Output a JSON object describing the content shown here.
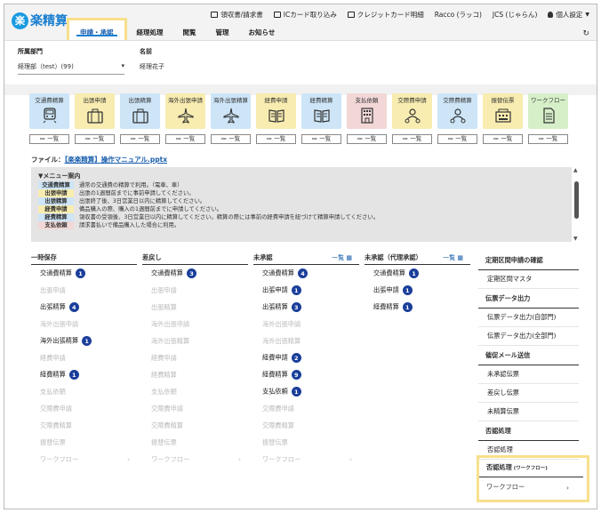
{
  "app": {
    "logo_mark": "楽",
    "logo_text": "楽精算"
  },
  "utils": [
    {
      "label": "領収書/請求書",
      "icon": "receipt-icon"
    },
    {
      "label": "ICカード取り込み",
      "icon": "ic-card-icon"
    },
    {
      "label": "クレジットカード明細",
      "icon": "credit-card-icon"
    },
    {
      "label": "Racco (ラッコ)",
      "icon": ""
    },
    {
      "label": "JCS (じゃらん)",
      "icon": ""
    },
    {
      "label": "個人設定",
      "icon": "person-icon"
    }
  ],
  "tabs": [
    "申請・承認",
    "経理処理",
    "閲覧",
    "管理",
    "お知らせ"
  ],
  "refresh_icon": "↻",
  "dept": {
    "label": "所属部門",
    "value": "経理部（test）(99)"
  },
  "name": {
    "label": "名前",
    "value": "経理花子"
  },
  "cards": [
    {
      "label": "交通費精算",
      "color": "blue",
      "icon": "train"
    },
    {
      "label": "出張申請",
      "color": "yellow",
      "icon": "bag"
    },
    {
      "label": "出張精算",
      "color": "blue",
      "icon": "bag"
    },
    {
      "label": "海外出張申請",
      "color": "yellow",
      "icon": "plane"
    },
    {
      "label": "海外出張精算",
      "color": "blue",
      "icon": "plane"
    },
    {
      "label": "経費申請",
      "color": "yellow",
      "icon": "book"
    },
    {
      "label": "経費精算",
      "color": "blue",
      "icon": "book"
    },
    {
      "label": "支払依頼",
      "color": "pink",
      "icon": "building"
    },
    {
      "label": "交際費申請",
      "color": "yellow",
      "icon": "people"
    },
    {
      "label": "交際費精算",
      "color": "blue",
      "icon": "people"
    },
    {
      "label": "振替伝票",
      "color": "yellow",
      "icon": "register"
    },
    {
      "label": "ワークフロー",
      "color": "green",
      "icon": "doc"
    }
  ],
  "list_button": "≔ 一覧",
  "manual": {
    "prefix": "ファイル：",
    "link": "【楽楽精算】操作マニュアル.pptx"
  },
  "menu_guide": {
    "title": "▼メニュー案内",
    "rows": [
      {
        "tag": "交通費精算",
        "color": "#cde5f7",
        "text": "通常の交通費の精算で利用。（電車、車）"
      },
      {
        "tag": "出張申請",
        "color": "#f8ecb0",
        "text": "出張の1週間前までに事前申請してください。"
      },
      {
        "tag": "出張精算",
        "color": "#cde5f7",
        "text": "出張終了後、3日営業日以内に精算してください。"
      },
      {
        "tag": "経費申請",
        "color": "#f8ecb0",
        "text": "備品購入の際、購入の1週間前までに申請してください。"
      },
      {
        "tag": "経費精算",
        "color": "#cde5f7",
        "text": "領収書の受領後、3日営業日以内に精算してください。精算の際には事前の経費申請を紐づけて精算申請してください。"
      },
      {
        "tag": "支払依頼",
        "color": "#f2d7d7",
        "text": "請求書払いで備品購入した場合に利用。"
      }
    ]
  },
  "columns": [
    {
      "title": "一時保存",
      "link": "",
      "items": [
        {
          "label": "交通費精算",
          "badge": "1",
          "enabled": true
        },
        {
          "label": "出張申請",
          "badge": "",
          "enabled": false
        },
        {
          "label": "出張精算",
          "badge": "4",
          "enabled": true
        },
        {
          "label": "海外出張申請",
          "badge": "",
          "enabled": false
        },
        {
          "label": "海外出張精算",
          "badge": "1",
          "enabled": true
        },
        {
          "label": "経費申請",
          "badge": "",
          "enabled": false
        },
        {
          "label": "経費精算",
          "badge": "1",
          "enabled": true
        },
        {
          "label": "支払依頼",
          "badge": "",
          "enabled": false
        },
        {
          "label": "交際費申請",
          "badge": "",
          "enabled": false
        },
        {
          "label": "交際費精算",
          "badge": "",
          "enabled": false
        },
        {
          "label": "振替伝票",
          "badge": "",
          "enabled": false
        },
        {
          "label": "ワークフロー",
          "badge": "",
          "enabled": false,
          "arrow": "›"
        }
      ]
    },
    {
      "title": "差戻し",
      "link": "",
      "items": [
        {
          "label": "交通費精算",
          "badge": "3",
          "enabled": true
        },
        {
          "label": "出張申請",
          "badge": "",
          "enabled": false
        },
        {
          "label": "出張精算",
          "badge": "",
          "enabled": false
        },
        {
          "label": "海外出張申請",
          "badge": "",
          "enabled": false
        },
        {
          "label": "海外出張精算",
          "badge": "",
          "enabled": false
        },
        {
          "label": "経費申請",
          "badge": "",
          "enabled": false
        },
        {
          "label": "経費精算",
          "badge": "",
          "enabled": false
        },
        {
          "label": "支払依頼",
          "badge": "",
          "enabled": false
        },
        {
          "label": "交際費申請",
          "badge": "",
          "enabled": false
        },
        {
          "label": "交際費精算",
          "badge": "",
          "enabled": false
        },
        {
          "label": "振替伝票",
          "badge": "",
          "enabled": false
        },
        {
          "label": "ワークフロー",
          "badge": "",
          "enabled": false,
          "arrow": "›"
        }
      ]
    },
    {
      "title": "未承認",
      "link": "一覧 ▦",
      "items": [
        {
          "label": "交通費精算",
          "badge": "4",
          "enabled": true
        },
        {
          "label": "出張申請",
          "badge": "1",
          "enabled": true
        },
        {
          "label": "出張精算",
          "badge": "3",
          "enabled": true
        },
        {
          "label": "海外出張申請",
          "badge": "",
          "enabled": false
        },
        {
          "label": "海外出張精算",
          "badge": "",
          "enabled": false
        },
        {
          "label": "経費申請",
          "badge": "2",
          "enabled": true
        },
        {
          "label": "経費精算",
          "badge": "9",
          "enabled": true
        },
        {
          "label": "支払依頼",
          "badge": "1",
          "enabled": true
        },
        {
          "label": "交際費申請",
          "badge": "",
          "enabled": false
        },
        {
          "label": "交際費精算",
          "badge": "",
          "enabled": false
        },
        {
          "label": "振替伝票",
          "badge": "",
          "enabled": false
        },
        {
          "label": "ワークフロー",
          "badge": "",
          "enabled": false,
          "arrow": "›"
        }
      ]
    },
    {
      "title": "未承認（代理承認）",
      "link": "一覧 ▦",
      "items": [
        {
          "label": "交通費精算",
          "badge": "1",
          "enabled": true
        },
        {
          "label": "出張申請",
          "badge": "1",
          "enabled": true
        },
        {
          "label": "経費精算",
          "badge": "1",
          "enabled": true
        }
      ]
    }
  ],
  "right": {
    "sections": [
      {
        "title": "定期区間申請の確認",
        "items": [
          "定期区間マスタ"
        ]
      },
      {
        "title": "伝票データ出力",
        "items": [
          "伝票データ出力(自部門)",
          "伝票データ出力(全部門)"
        ]
      },
      {
        "title": "催促メール送信",
        "items": [
          "未承認伝票",
          "差戻し伝票",
          "未精算伝票"
        ]
      },
      {
        "title": "否認処理",
        "items": [
          "否認処理"
        ]
      }
    ],
    "highlight": {
      "title": "否認処理",
      "sub": "(ワークフロー)",
      "item": "ワークフロー",
      "arrow": "›"
    }
  }
}
